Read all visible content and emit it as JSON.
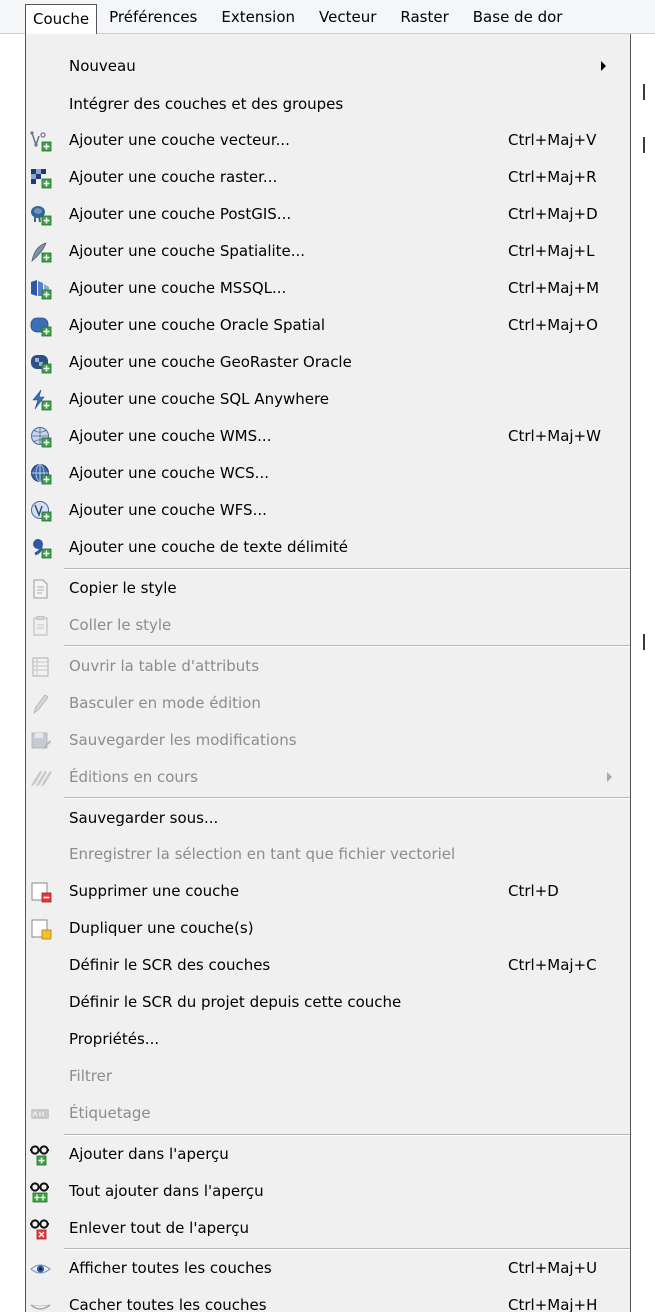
{
  "menubar": {
    "items": [
      "Couche",
      "Préférences",
      "Extension",
      "Vecteur",
      "Raster",
      "Base de dor"
    ]
  },
  "menu": {
    "nouveau": "Nouveau",
    "integrer": "Intégrer des couches et des groupes",
    "vector": {
      "label": "Ajouter une couche vecteur...",
      "shortcut": "Ctrl+Maj+V"
    },
    "raster": {
      "label": "Ajouter une couche raster...",
      "shortcut": "Ctrl+Maj+R"
    },
    "postgis": {
      "label": "Ajouter une couche PostGIS...",
      "shortcut": "Ctrl+Maj+D"
    },
    "spatialite": {
      "label": "Ajouter une couche Spatialite...",
      "shortcut": "Ctrl+Maj+L"
    },
    "mssql": {
      "label": "Ajouter une couche MSSQL...",
      "shortcut": "Ctrl+Maj+M"
    },
    "oracle": {
      "label": "Ajouter une couche Oracle Spatial",
      "shortcut": "Ctrl+Maj+O"
    },
    "georaster": {
      "label": "Ajouter une couche GeoRaster Oracle"
    },
    "sqlanywhere": {
      "label": "Ajouter une couche SQL Anywhere"
    },
    "wms": {
      "label": "Ajouter une couche WMS...",
      "shortcut": "Ctrl+Maj+W"
    },
    "wcs": {
      "label": "Ajouter une couche WCS..."
    },
    "wfs": {
      "label": "Ajouter une couche WFS..."
    },
    "delimited": {
      "label": "Ajouter une couche de texte délimité"
    },
    "copy_style": "Copier le style",
    "paste_style": "Coller le style",
    "attr_table": "Ouvrir la table d'attributs",
    "toggle_edit": "Basculer en mode édition",
    "save_edits": "Sauvegarder les modifications",
    "current_edits": "Éditions en cours",
    "save_as": "Sauvegarder sous...",
    "save_selection": "Enregistrer la sélection en tant que fichier vectoriel",
    "remove_layer": {
      "label": "Supprimer une couche",
      "shortcut": "Ctrl+D"
    },
    "duplicate_layer": "Dupliquer une couche(s)",
    "set_crs": {
      "label": "Définir le SCR des couches",
      "shortcut": "Ctrl+Maj+C"
    },
    "set_project_crs": "Définir le SCR du projet depuis cette couche",
    "properties": "Propriétés...",
    "filter": "Filtrer",
    "labeling": "Étiquetage",
    "add_overview": "Ajouter dans l'aperçu",
    "add_all_overview": "Tout ajouter dans l'aperçu",
    "remove_all_overview": "Enlever tout de l'aperçu",
    "show_all": {
      "label": "Afficher toutes les couches",
      "shortcut": "Ctrl+Maj+U"
    },
    "hide_all": {
      "label": "Cacher toutes les couches",
      "shortcut": "Ctrl+Maj+H"
    }
  }
}
